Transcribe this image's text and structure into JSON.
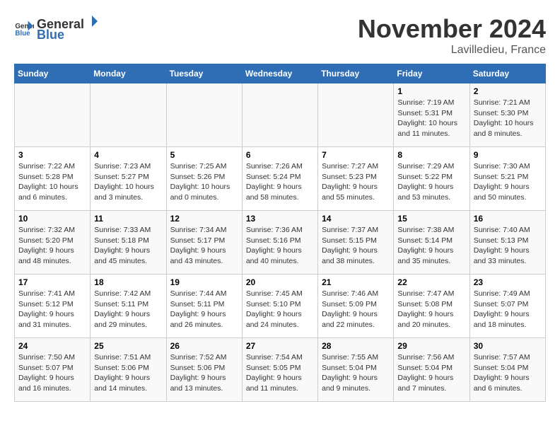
{
  "header": {
    "logo_general": "General",
    "logo_blue": "Blue",
    "month_title": "November 2024",
    "location": "Lavilledieu, France"
  },
  "weekdays": [
    "Sunday",
    "Monday",
    "Tuesday",
    "Wednesday",
    "Thursday",
    "Friday",
    "Saturday"
  ],
  "weeks": [
    [
      {
        "day": "",
        "info": ""
      },
      {
        "day": "",
        "info": ""
      },
      {
        "day": "",
        "info": ""
      },
      {
        "day": "",
        "info": ""
      },
      {
        "day": "",
        "info": ""
      },
      {
        "day": "1",
        "info": "Sunrise: 7:19 AM\nSunset: 5:31 PM\nDaylight: 10 hours and 11 minutes."
      },
      {
        "day": "2",
        "info": "Sunrise: 7:21 AM\nSunset: 5:30 PM\nDaylight: 10 hours and 8 minutes."
      }
    ],
    [
      {
        "day": "3",
        "info": "Sunrise: 7:22 AM\nSunset: 5:28 PM\nDaylight: 10 hours and 6 minutes."
      },
      {
        "day": "4",
        "info": "Sunrise: 7:23 AM\nSunset: 5:27 PM\nDaylight: 10 hours and 3 minutes."
      },
      {
        "day": "5",
        "info": "Sunrise: 7:25 AM\nSunset: 5:26 PM\nDaylight: 10 hours and 0 minutes."
      },
      {
        "day": "6",
        "info": "Sunrise: 7:26 AM\nSunset: 5:24 PM\nDaylight: 9 hours and 58 minutes."
      },
      {
        "day": "7",
        "info": "Sunrise: 7:27 AM\nSunset: 5:23 PM\nDaylight: 9 hours and 55 minutes."
      },
      {
        "day": "8",
        "info": "Sunrise: 7:29 AM\nSunset: 5:22 PM\nDaylight: 9 hours and 53 minutes."
      },
      {
        "day": "9",
        "info": "Sunrise: 7:30 AM\nSunset: 5:21 PM\nDaylight: 9 hours and 50 minutes."
      }
    ],
    [
      {
        "day": "10",
        "info": "Sunrise: 7:32 AM\nSunset: 5:20 PM\nDaylight: 9 hours and 48 minutes."
      },
      {
        "day": "11",
        "info": "Sunrise: 7:33 AM\nSunset: 5:18 PM\nDaylight: 9 hours and 45 minutes."
      },
      {
        "day": "12",
        "info": "Sunrise: 7:34 AM\nSunset: 5:17 PM\nDaylight: 9 hours and 43 minutes."
      },
      {
        "day": "13",
        "info": "Sunrise: 7:36 AM\nSunset: 5:16 PM\nDaylight: 9 hours and 40 minutes."
      },
      {
        "day": "14",
        "info": "Sunrise: 7:37 AM\nSunset: 5:15 PM\nDaylight: 9 hours and 38 minutes."
      },
      {
        "day": "15",
        "info": "Sunrise: 7:38 AM\nSunset: 5:14 PM\nDaylight: 9 hours and 35 minutes."
      },
      {
        "day": "16",
        "info": "Sunrise: 7:40 AM\nSunset: 5:13 PM\nDaylight: 9 hours and 33 minutes."
      }
    ],
    [
      {
        "day": "17",
        "info": "Sunrise: 7:41 AM\nSunset: 5:12 PM\nDaylight: 9 hours and 31 minutes."
      },
      {
        "day": "18",
        "info": "Sunrise: 7:42 AM\nSunset: 5:11 PM\nDaylight: 9 hours and 29 minutes."
      },
      {
        "day": "19",
        "info": "Sunrise: 7:44 AM\nSunset: 5:11 PM\nDaylight: 9 hours and 26 minutes."
      },
      {
        "day": "20",
        "info": "Sunrise: 7:45 AM\nSunset: 5:10 PM\nDaylight: 9 hours and 24 minutes."
      },
      {
        "day": "21",
        "info": "Sunrise: 7:46 AM\nSunset: 5:09 PM\nDaylight: 9 hours and 22 minutes."
      },
      {
        "day": "22",
        "info": "Sunrise: 7:47 AM\nSunset: 5:08 PM\nDaylight: 9 hours and 20 minutes."
      },
      {
        "day": "23",
        "info": "Sunrise: 7:49 AM\nSunset: 5:07 PM\nDaylight: 9 hours and 18 minutes."
      }
    ],
    [
      {
        "day": "24",
        "info": "Sunrise: 7:50 AM\nSunset: 5:07 PM\nDaylight: 9 hours and 16 minutes."
      },
      {
        "day": "25",
        "info": "Sunrise: 7:51 AM\nSunset: 5:06 PM\nDaylight: 9 hours and 14 minutes."
      },
      {
        "day": "26",
        "info": "Sunrise: 7:52 AM\nSunset: 5:06 PM\nDaylight: 9 hours and 13 minutes."
      },
      {
        "day": "27",
        "info": "Sunrise: 7:54 AM\nSunset: 5:05 PM\nDaylight: 9 hours and 11 minutes."
      },
      {
        "day": "28",
        "info": "Sunrise: 7:55 AM\nSunset: 5:04 PM\nDaylight: 9 hours and 9 minutes."
      },
      {
        "day": "29",
        "info": "Sunrise: 7:56 AM\nSunset: 5:04 PM\nDaylight: 9 hours and 7 minutes."
      },
      {
        "day": "30",
        "info": "Sunrise: 7:57 AM\nSunset: 5:04 PM\nDaylight: 9 hours and 6 minutes."
      }
    ]
  ]
}
